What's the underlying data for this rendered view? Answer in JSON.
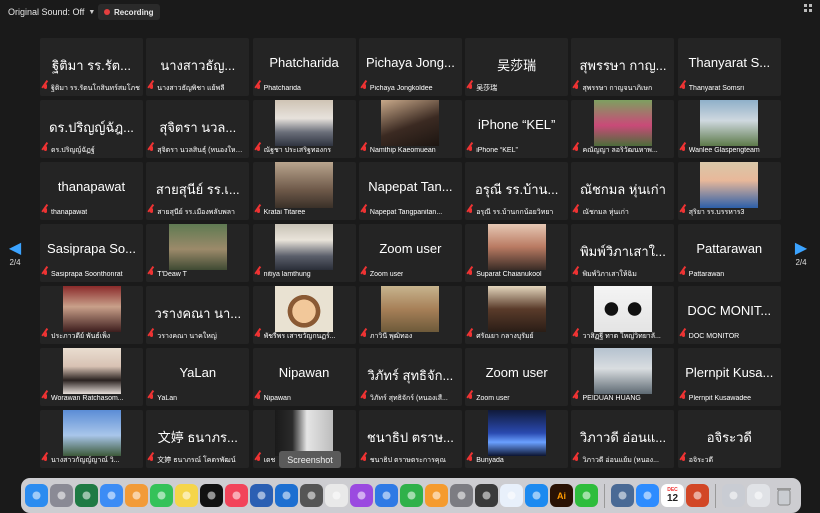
{
  "topbar": {
    "original_sound": "Original Sound: Off",
    "recording": "Recording"
  },
  "pagination": {
    "page": "2/4"
  },
  "tooltip": "Screenshot",
  "tiles": [
    {
      "big": "ฐิติมา รร.รัต...",
      "name": "ฐิติมา รร.รัตนโกสินทร์สมโภช",
      "photo": null
    },
    {
      "big": "นางสาวธัญ...",
      "name": "นางสาวธัญพิชา แย้พลี",
      "photo": null
    },
    {
      "big": "Phatcharida",
      "name": "Phatcharida",
      "photo": null
    },
    {
      "big": "Pichaya Jong...",
      "name": "Pichaya Jongkoldee",
      "photo": null
    },
    {
      "big": "吴莎瑞",
      "name": "吴莎瑞",
      "photo": null
    },
    {
      "big": "สุพรรษา กาญ...",
      "name": "สุพรรษา กาญจนาภิเษก",
      "photo": null
    },
    {
      "big": "Thanyarat S...",
      "name": "Thanyarat Somsri",
      "photo": null
    },
    {
      "big": "ดร.ปริญญ์ฉัฎ...",
      "name": "ดร.ปริญญ์ฉัฏฐ์",
      "photo": null
    },
    {
      "big": "สุจิตรา นวล...",
      "name": "สุจิตรา นวลสินธุ์ (หนองใหญ่...",
      "photo": null
    },
    {
      "big": "",
      "name": "ณัฐชา ประเสริฐทองกร",
      "photo": "p-uniform"
    },
    {
      "big": "",
      "name": "Namthip Kaeomuean",
      "photo": "p-woman"
    },
    {
      "big": "iPhone “KEL”",
      "name": "iPhone “KEL”",
      "photo": null
    },
    {
      "big": "",
      "name": "คณัญญา ลอริวัฒนหาพ...",
      "photo": "p-garden"
    },
    {
      "big": "",
      "name": "Wanlee Glaspengteam",
      "photo": "p-monument"
    },
    {
      "big": "thanapawat",
      "name": "thanapawat",
      "photo": null
    },
    {
      "big": "สายสุนีย์ รร.เ...",
      "name": "สายสุนีย์ รร.เมืองพลับพลา",
      "photo": null
    },
    {
      "big": "",
      "name": "Kratai Titaree",
      "photo": "p-street"
    },
    {
      "big": "Napepat Tan...",
      "name": "Napepat Tangpanitan...",
      "photo": null
    },
    {
      "big": "อรุณี รร.บ้าน...",
      "name": "อรุณี รร.บ้านกกน้อยวิทยา",
      "photo": null
    },
    {
      "big": "ณัชกมล หุ่นเก่า",
      "name": "ณัชกมล หุ่นเก่า",
      "photo": null
    },
    {
      "big": "",
      "name": "สุริยา รร.บรรหาร3",
      "photo": "p-man-glasses"
    },
    {
      "big": "Sasiprapa So...",
      "name": "Sasiprapa Soonthonrat",
      "photo": null
    },
    {
      "big": "",
      "name": "T'Deaw T",
      "photo": "p-forest"
    },
    {
      "big": "",
      "name": "nitiya lamthung",
      "photo": "p-uniform2"
    },
    {
      "big": "Zoom user",
      "name": "Zoom user",
      "photo": null
    },
    {
      "big": "",
      "name": "Suparat Chaianukool",
      "photo": "p-beach"
    },
    {
      "big": "พิมพ์วิภาเสาใ...",
      "name": "พิมพ์วิภาเสาให้ฉิม",
      "photo": null
    },
    {
      "big": "Pattarawan",
      "name": "Pattarawan",
      "photo": null
    },
    {
      "big": "",
      "name": "ประภาวดีย์ พันธ์เพ็ง",
      "photo": "p-redroom"
    },
    {
      "big": "วรางคณา นา...",
      "name": "วรางคณา นาคใหญ่",
      "photo": null
    },
    {
      "big": "",
      "name": "พัชรีพร เสาขวัญกนฏร์...",
      "photo": "p-cartoon"
    },
    {
      "big": "",
      "name": "ภาวินี พุฒิทอง",
      "photo": "p-field"
    },
    {
      "big": "",
      "name": "ศรัณยา กลางบุรัมย์",
      "photo": "p-woman2"
    },
    {
      "big": "",
      "name": "วาสิฏฐี ทาต ใหญ่วิทยาลั...",
      "photo": "p-panda"
    },
    {
      "big": "DOC MONIT...",
      "name": "DOC MONITOR",
      "photo": null
    },
    {
      "big": "",
      "name": "Worawan Ratchasom...",
      "photo": "p-girl"
    },
    {
      "big": "YaLan",
      "name": "YaLan",
      "photo": null
    },
    {
      "big": "Nipawan",
      "name": "Nipawan",
      "photo": null
    },
    {
      "big": "วิภัทร์ สุทธิจัก...",
      "name": "วิภัทร์ สุทธิจักร์ (หนองเสื...",
      "photo": null
    },
    {
      "big": "Zoom user",
      "name": "Zoom user",
      "photo": null
    },
    {
      "big": "",
      "name": "PEIDUAN HUANG",
      "photo": "p-lake"
    },
    {
      "big": "Plernpit Kusa...",
      "name": "Plernpit Kusawadee",
      "photo": null
    },
    {
      "big": "",
      "name": "นางสาวกัญญ์ญาณ์ วิ...",
      "photo": "p-sky"
    },
    {
      "big": "文婷 ธนาภร...",
      "name": "文婷 ธนาภรณ์ โคตรพัฒน์",
      "photo": null
    },
    {
      "big": "",
      "name": "เดช",
      "photo": "p-present"
    },
    {
      "big": "ชนาธิป ตราษ...",
      "name": "ชนาธิป ตราษตระการคุณ",
      "photo": null
    },
    {
      "big": "",
      "name": "Bunyada",
      "photo": "p-night"
    },
    {
      "big": "วิภาวดี อ่อนแ...",
      "name": "วิภาวดี อ่อนแย้ม (หนอง...",
      "photo": null
    },
    {
      "big": "อจิระวดี",
      "name": "อจิระวดี",
      "photo": null
    }
  ],
  "dock": [
    {
      "icon": "finder-icon",
      "color": "#2b8cf0"
    },
    {
      "icon": "launchpad-icon",
      "color": "#8a8a95"
    },
    {
      "icon": "excel-icon",
      "color": "#1f7a44"
    },
    {
      "icon": "mail-icon",
      "color": "#3c8cf5"
    },
    {
      "icon": "photos-icon",
      "color": "#f29b38"
    },
    {
      "icon": "facetime-icon",
      "color": "#34c259"
    },
    {
      "icon": "notes-icon",
      "color": "#f5d54a"
    },
    {
      "icon": "appletv-icon",
      "color": "#111111"
    },
    {
      "icon": "music-icon",
      "color": "#f2445a"
    },
    {
      "icon": "word-icon",
      "color": "#2b5fb3"
    },
    {
      "icon": "outlook-icon",
      "color": "#1d6fd1"
    },
    {
      "icon": "screenshot-icon",
      "color": "#555555"
    },
    {
      "icon": "chrome-icon",
      "color": "#e9e9e9"
    },
    {
      "icon": "podcasts-icon",
      "color": "#9b4ae0"
    },
    {
      "icon": "keynote-icon",
      "color": "#2f7ae5"
    },
    {
      "icon": "numbers-icon",
      "color": "#2fb14a"
    },
    {
      "icon": "pages-icon",
      "color": "#f59b2e"
    },
    {
      "icon": "settings-icon",
      "color": "#7c7c82"
    },
    {
      "icon": "calculator-icon",
      "color": "#3a3a3a"
    },
    {
      "icon": "safari-icon",
      "color": "#e8f0fb"
    },
    {
      "icon": "appstore-icon",
      "color": "#1c8af0"
    },
    {
      "icon": "illustrator-icon",
      "color": "#2a1204"
    },
    {
      "icon": "line-icon",
      "color": "#2ebd3c"
    },
    {
      "icon": "finder-window-icon",
      "color": "#4a6a95"
    },
    {
      "icon": "zoom-icon",
      "color": "#2d8cff"
    },
    {
      "icon": "calendar-icon",
      "color": "#ffffff"
    },
    {
      "icon": "powerpoint-icon",
      "color": "#d24726"
    },
    {
      "icon": "preview-icon",
      "color": "#c9ccd3"
    },
    {
      "icon": "downloads-icon",
      "color": "#e0e2e6"
    },
    {
      "icon": "trash-icon",
      "color": "#b5b8bd"
    }
  ],
  "dock_calendar": {
    "month": "DEC",
    "day": "12"
  },
  "dock_illustrator_label": "Ai"
}
